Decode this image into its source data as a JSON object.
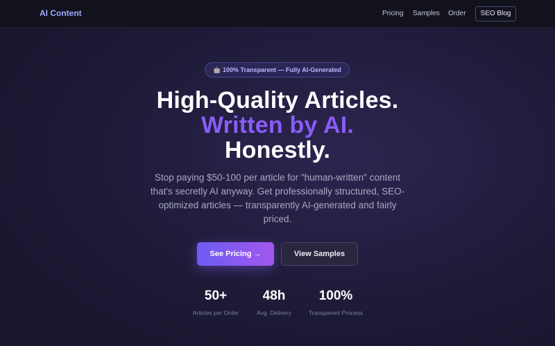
{
  "nav": {
    "logo": "AI Content",
    "links": [
      "Pricing",
      "Samples",
      "Order"
    ],
    "blog_button": "SEO Blog"
  },
  "hero": {
    "badge": "🤖 100% Transparent — Fully AI-Generated",
    "title_line1": "High-Quality Articles.",
    "title_line2": "Written by AI.",
    "title_line3": "Honestly.",
    "subtitle": "Stop paying $50-100 per article for \"human-written\" content that's secretly AI anyway. Get professionally structured, SEO-optimized articles — transparently AI-generated and fairly priced.",
    "primary_button": "See Pricing →",
    "secondary_button": "View Samples",
    "stats": [
      {
        "value": "50+",
        "label": "Articles per Order"
      },
      {
        "value": "48h",
        "label": "Avg. Delivery"
      },
      {
        "value": "100%",
        "label": "Transparent Process"
      }
    ]
  },
  "colors": {
    "accent": "#8a5cf6",
    "logo": "#9fa8ff",
    "background": "#1d1a36"
  }
}
